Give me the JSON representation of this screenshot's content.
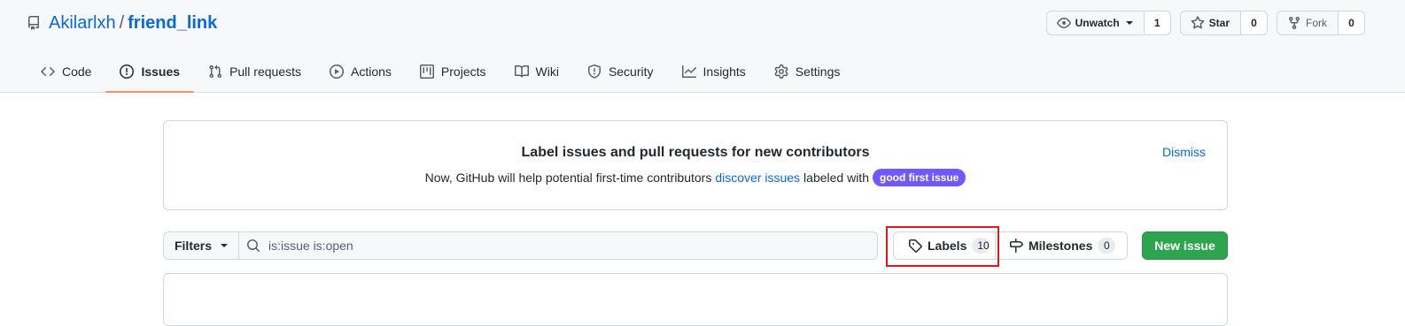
{
  "repo": {
    "owner": "Akilarlxh",
    "separator": "/",
    "name": "friend_link"
  },
  "actions": {
    "watch": {
      "label": "Unwatch",
      "count": "1"
    },
    "star": {
      "label": "Star",
      "count": "0"
    },
    "fork": {
      "label": "Fork",
      "count": "0"
    }
  },
  "tabs": [
    {
      "label": "Code",
      "icon": "code-icon"
    },
    {
      "label": "Issues",
      "icon": "issue-opened-icon",
      "selected": true
    },
    {
      "label": "Pull requests",
      "icon": "git-pull-request-icon"
    },
    {
      "label": "Actions",
      "icon": "play-icon"
    },
    {
      "label": "Projects",
      "icon": "project-icon"
    },
    {
      "label": "Wiki",
      "icon": "book-icon"
    },
    {
      "label": "Security",
      "icon": "shield-icon"
    },
    {
      "label": "Insights",
      "icon": "graph-icon"
    },
    {
      "label": "Settings",
      "icon": "gear-icon"
    }
  ],
  "banner": {
    "title": "Label issues and pull requests for new contributors",
    "text_before": "Now, GitHub will help potential first-time contributors",
    "link": "discover issues",
    "text_after": "labeled with",
    "label": "good first issue",
    "label_color": "#7057ff",
    "dismiss": "Dismiss"
  },
  "filters": {
    "button": "Filters",
    "search_value": "is:issue is:open"
  },
  "labels": {
    "label": "Labels",
    "count": "10"
  },
  "milestones": {
    "label": "Milestones",
    "count": "0"
  },
  "new_issue": "New issue",
  "colors": {
    "accent": "#0969da",
    "primary_button": "#2da44e",
    "tab_underline": "#fd8c73",
    "highlight": "#e0181e"
  }
}
